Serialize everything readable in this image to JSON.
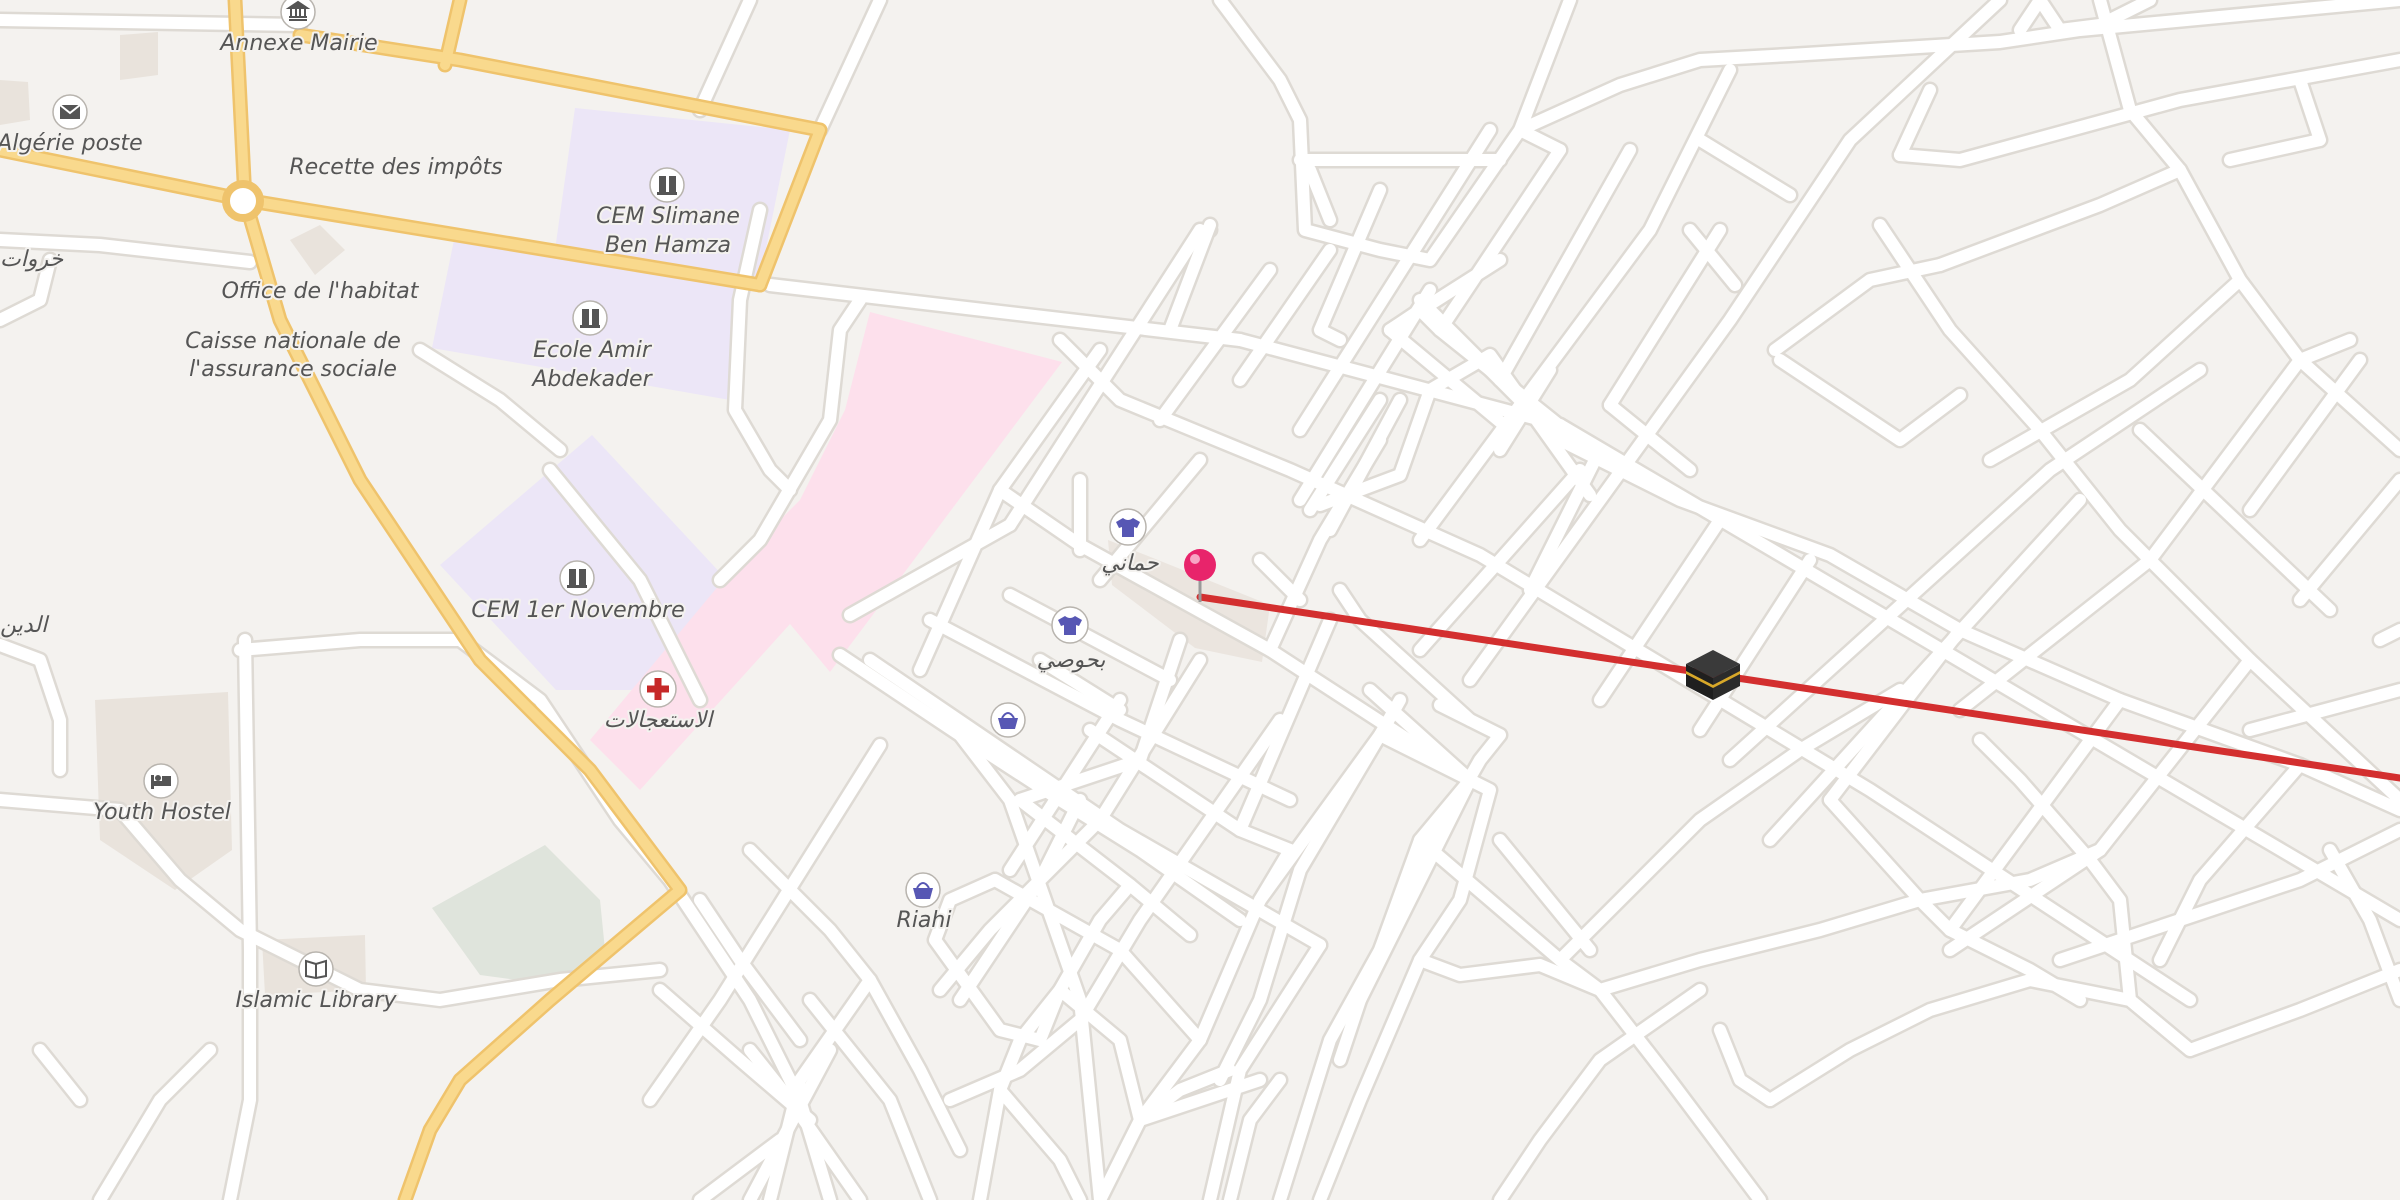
{
  "map": {
    "colors": {
      "background": "#f4f2ef",
      "road": "#ffffff",
      "road_casing": "#dedad4",
      "main_road": "#f9d98d",
      "main_road_casing": "#efc36c",
      "school_area": "#ece6f7",
      "hospital_area": "#fde0ec",
      "park_area": "#dfe4dc",
      "building": "#e9e3dc",
      "route_line": "#d32f2f",
      "pin": "#e8246b",
      "shop_icon": "#5757b4",
      "hospital_icon": "#c62828"
    },
    "labels": {
      "annexe_mairie": "Annexe Mairie",
      "algerie_poste": "Algérie poste",
      "recette_impots": "Recette des impôts",
      "cem_slimane_1": "CEM Slimane",
      "cem_slimane_2": "Ben Hamza",
      "kharrouat": "خروات",
      "office_habitat": "Office de l'habitat",
      "caisse_1": "Caisse nationale de",
      "caisse_2": "l'assurance sociale",
      "ecole_1": "Ecole Amir",
      "ecole_2": "Abdekader",
      "cem_1er": "CEM 1er Novembre",
      "eddine": "الدين",
      "urgences": "الاستعجالات",
      "youth_hostel": "Youth Hostel",
      "islamic_library": "Islamic Library",
      "riahi": "Riahi",
      "hammani": "حماني",
      "bahoussi": "بحوصي"
    },
    "icons": {
      "annexe_mairie": "town-hall-icon",
      "algerie_poste": "mail-icon",
      "cem_slimane": "school-icon",
      "ecole_amir": "school-icon",
      "cem_1er": "school-icon",
      "urgences": "hospital-cross-icon",
      "youth_hostel": "bed-icon",
      "islamic_library": "book-icon",
      "riahi": "shopping-basket-icon",
      "unnamed_shop": "shopping-basket-icon",
      "hammani": "clothes-shop-icon",
      "bahoussi": "clothes-shop-icon",
      "location_pin": "location-pin-icon",
      "kaaba": "kaaba-icon"
    }
  }
}
